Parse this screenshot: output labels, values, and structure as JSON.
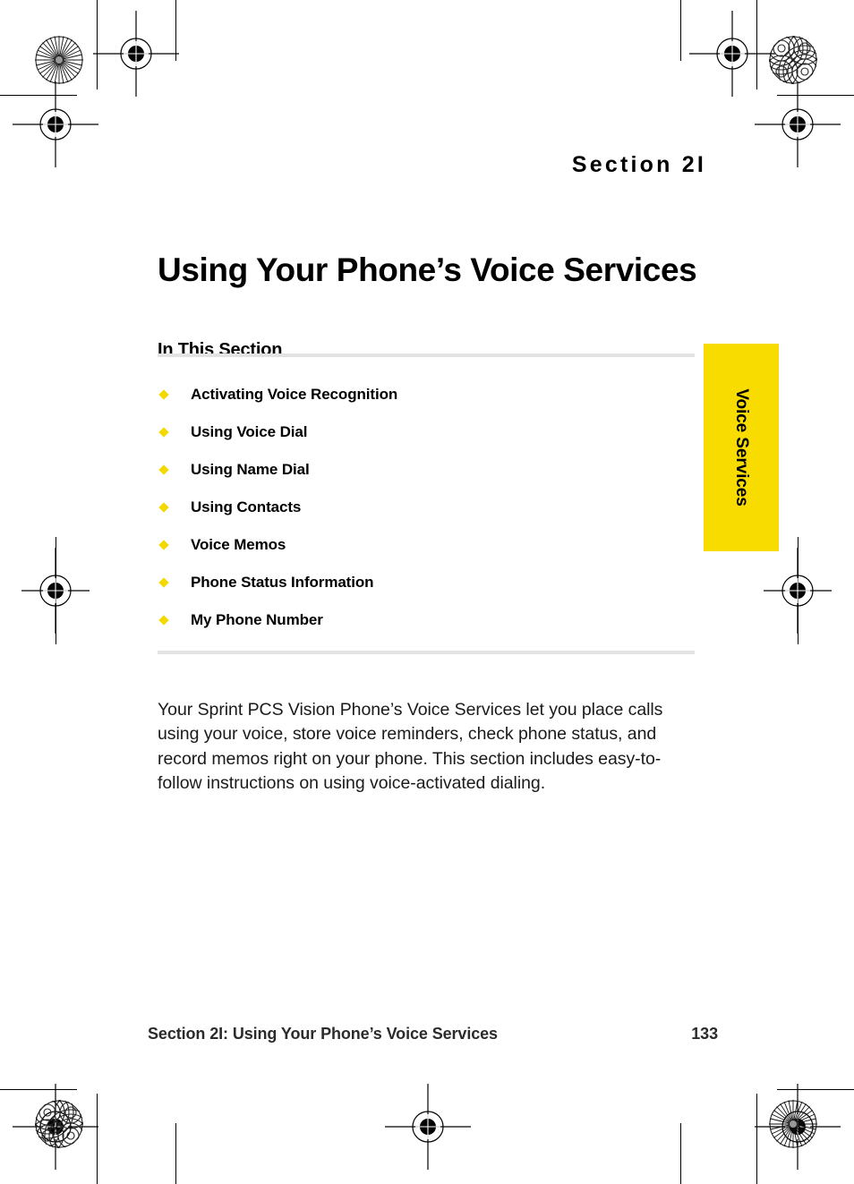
{
  "page": {
    "section_label": "Section 2I",
    "title": "Using Your Phone’s Voice Services",
    "in_this_section_heading": "In This Section",
    "body_paragraph": "Your Sprint PCS Vision Phone’s Voice Services let you place calls using your voice, store voice reminders, check phone status, and record memos right on your phone. This section includes easy-to-follow instructions on using voice-activated dialing."
  },
  "toc": {
    "items": [
      {
        "label": "Activating Voice Recognition",
        "bullet": "diamond-bullet"
      },
      {
        "label": "Using Voice Dial",
        "bullet": "diamond-bullet"
      },
      {
        "label": "Using Name Dial",
        "bullet": "diamond-bullet"
      },
      {
        "label": "Using Contacts",
        "bullet": "diamond-bullet"
      },
      {
        "label": "Voice Memos",
        "bullet": "diamond-bullet"
      },
      {
        "label": "Phone Status Information",
        "bullet": "diamond-bullet"
      },
      {
        "label": "My Phone Number",
        "bullet": "diamond-bullet"
      }
    ]
  },
  "side_tab": {
    "label": "Voice Services",
    "color": "#f8dc00"
  },
  "footer": {
    "left": "Section 2I: Using Your Phone’s Voice Services",
    "page_number": "133"
  },
  "colors": {
    "bullet_yellow": "#f5d800",
    "tab_yellow": "#f8dc00",
    "rule_gray": "#e3e3e3",
    "text_black": "#000000"
  },
  "print_marks": {
    "registration_targets": [
      "registration-target-top-left",
      "registration-target-top-left-inner",
      "registration-target-top-right-inner",
      "registration-target-top-right",
      "registration-target-mid-left",
      "registration-target-mid-right",
      "registration-target-bottom-left",
      "registration-target-bottom-center",
      "registration-target-bottom-right"
    ],
    "rosettes": [
      "rosette-starburst-top-left",
      "rosette-moire-top-right",
      "rosette-moire-bottom-left",
      "rosette-starburst-bottom-right"
    ]
  }
}
